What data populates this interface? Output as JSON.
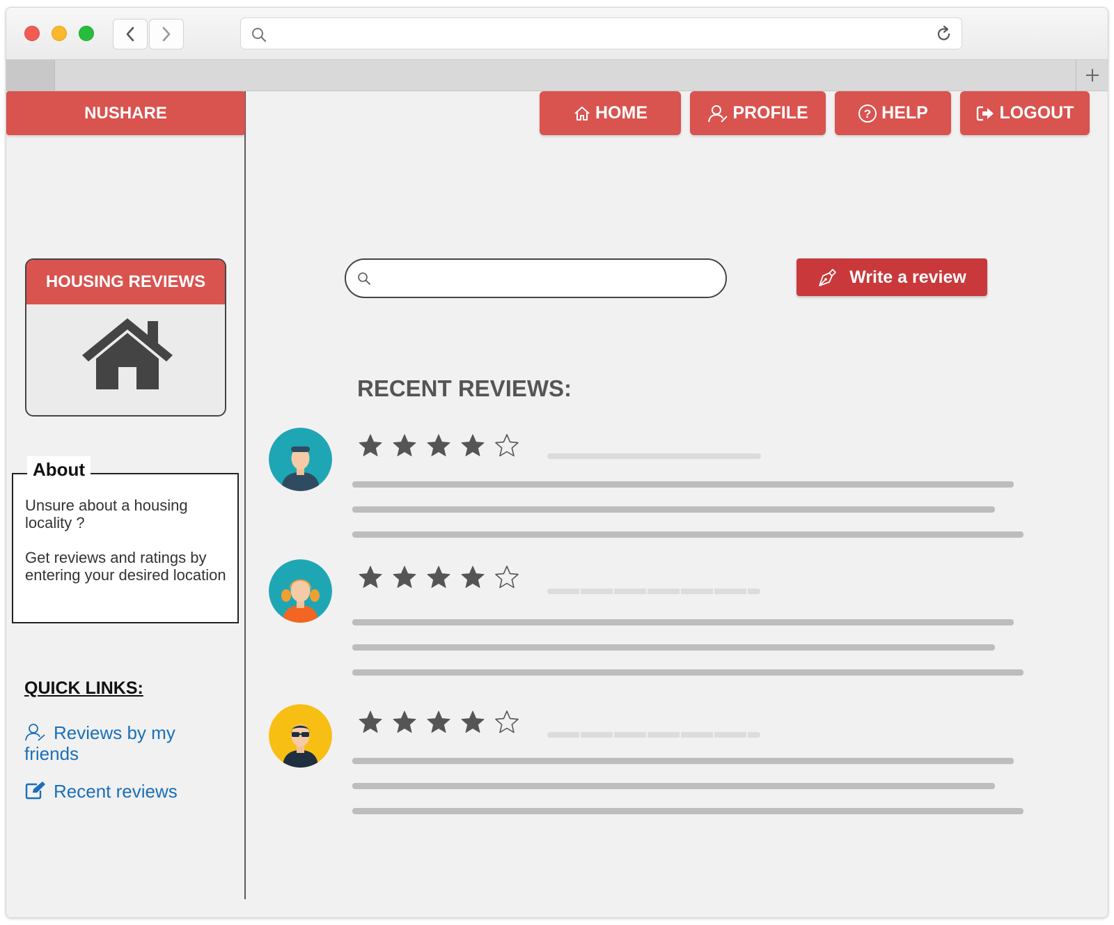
{
  "browser": {
    "url": "",
    "new_tab_icon": "plus-icon"
  },
  "brand": "NUSHARE",
  "nav": {
    "home": "HOME",
    "profile": "PROFILE",
    "help": "HELP",
    "logout": "LOGOUT"
  },
  "sidebar": {
    "housing_card_title": "HOUSING REVIEWS",
    "about_title": "About",
    "about_line1": "Unsure about a housing locality ?",
    "about_line2": "Get reviews and ratings by entering your desired location",
    "quick_links_title": "QUICK LINKS:",
    "link_friends": "Reviews by my friends",
    "link_recent": "Recent reviews"
  },
  "main": {
    "search_value": "",
    "write_review": "Write a review",
    "recent_title": "RECENT REVIEWS:",
    "reviews": [
      {
        "avatar": "man-avatar",
        "rating": 4,
        "max_rating": 5
      },
      {
        "avatar": "woman-avatar",
        "rating": 4,
        "max_rating": 5
      },
      {
        "avatar": "sunglasses-man-avatar",
        "rating": 4,
        "max_rating": 5
      }
    ]
  },
  "colors": {
    "accent": "#d9534f",
    "button_dark": "#c9393b",
    "link": "#1a6fb8"
  }
}
